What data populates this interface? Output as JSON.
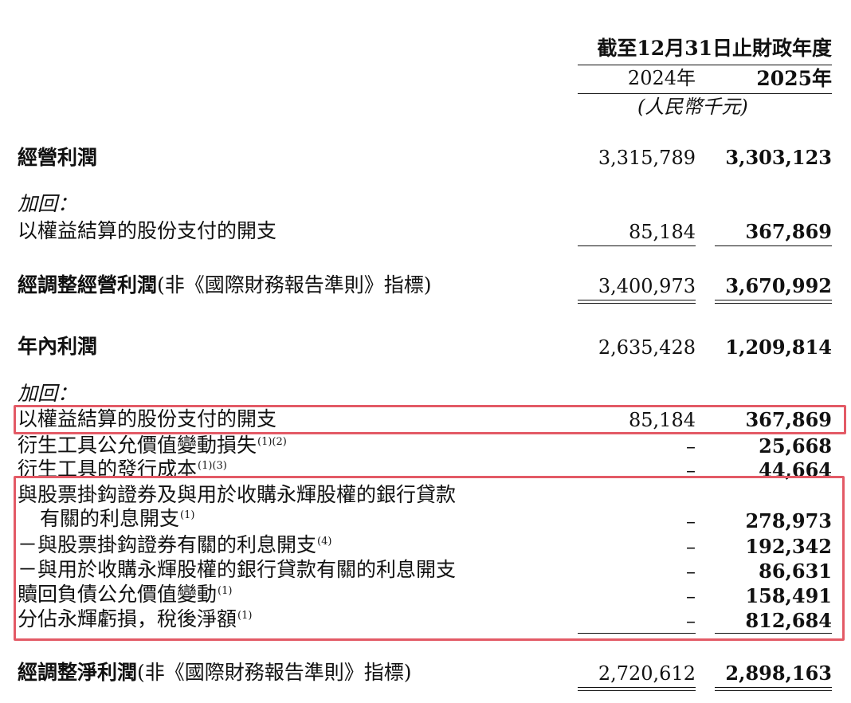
{
  "header": {
    "period": "截至12月31日止財政年度",
    "year_2024": "2024年",
    "year_2025": "2025年",
    "unit": "(人民幣千元)"
  },
  "rows": {
    "operating_profit": {
      "label": "經營利潤",
      "v2024": "3,315,789",
      "v2025": "3,303,123"
    },
    "addback_1": {
      "label": "加回："
    },
    "sbc_1": {
      "label": "以權益結算的股份支付的開支",
      "v2024": "85,184",
      "v2025": "367,869"
    },
    "adj_operating_profit": {
      "label_bold": "經調整經營利潤",
      "label_note": "(非《國際財務報告準則》指標)",
      "v2024": "3,400,973",
      "v2025": "3,670,992"
    },
    "profit_year": {
      "label": "年內利潤",
      "v2024": "2,635,428",
      "v2025": "1,209,814"
    },
    "addback_2": {
      "label": "加回："
    },
    "sbc_2": {
      "label": "以權益結算的股份支付的開支",
      "v2024": "85,184",
      "v2025": "367,869"
    },
    "deriv_fv": {
      "label": "衍生工具公允價值變動損失",
      "note": "(1)(2)",
      "v2024": "–",
      "v2025": "25,668"
    },
    "deriv_issue": {
      "label": "衍生工具的發行成本",
      "note": "(1)(3)",
      "v2024": "–",
      "v2025": "44,664"
    },
    "interest_line1": {
      "label": "與股票掛鈎證券及與用於收購永輝股權的銀行貸款"
    },
    "interest_line2": {
      "label": "有關的利息開支",
      "note": "(1)",
      "v2024": "–",
      "v2025": "278,973"
    },
    "interest_sub1": {
      "label": "－與股票掛鈎證券有關的利息開支",
      "note": "(4)",
      "v2024": "–",
      "v2025": "192,342"
    },
    "interest_sub2": {
      "label": "－與用於收購永輝股權的銀行貸款有關的利息開支",
      "v2024": "–",
      "v2025": "86,631"
    },
    "redemption": {
      "label": "贖回負債公允價值變動",
      "note": "(1)",
      "v2024": "–",
      "v2025": "158,491"
    },
    "yonghui_loss": {
      "label": "分佔永輝虧損，稅後淨額",
      "note": "(1)",
      "v2024": "–",
      "v2025": "812,684"
    },
    "adj_net_profit": {
      "label_bold": "經調整淨利潤",
      "label_note": "(非《國際財務報告準則》指標)",
      "v2024": "2,720,612",
      "v2025": "2,898,163"
    }
  },
  "highlight_color": "#e35a66"
}
